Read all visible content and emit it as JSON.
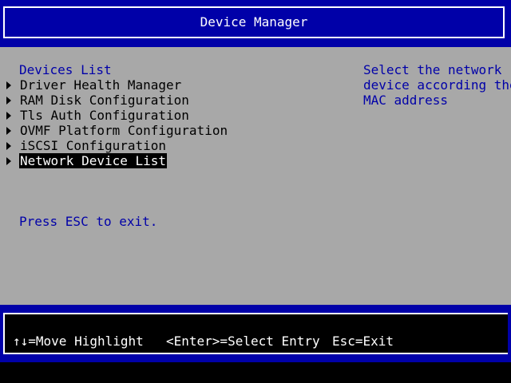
{
  "header": {
    "title": "Device Manager"
  },
  "menu": {
    "heading": "Devices List",
    "items": [
      {
        "label": "Driver Health Manager",
        "selected": false
      },
      {
        "label": "RAM Disk Configuration",
        "selected": false
      },
      {
        "label": "Tls Auth Configuration",
        "selected": false
      },
      {
        "label": "OVMF Platform Configuration",
        "selected": false
      },
      {
        "label": "iSCSI Configuration",
        "selected": false
      },
      {
        "label": "Network Device List",
        "selected": true
      }
    ],
    "exit_hint": "Press ESC to exit."
  },
  "help": {
    "lines": [
      "Select the network",
      "device according the",
      "MAC address"
    ]
  },
  "footer": {
    "move_hint": "↑↓=Move Highlight",
    "enter_hint": "<Enter>=Select Entry",
    "esc_hint": "Esc=Exit"
  },
  "colors": {
    "title_background": "#0000a8",
    "content_background": "#a8a8a8",
    "heading_text": "#0000a8",
    "selection_background": "#000000",
    "selection_text": "#ffffff"
  }
}
